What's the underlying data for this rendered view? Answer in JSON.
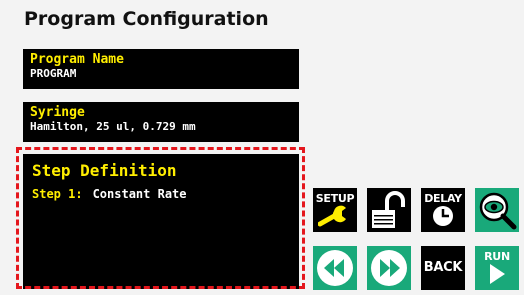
{
  "page": {
    "title": "Program Configuration"
  },
  "program": {
    "label": "Program Name",
    "value": "PROGRAM"
  },
  "syringe": {
    "label": "Syringe",
    "value": "Hamilton, 25 ul, 0.729 mm"
  },
  "step": {
    "title": "Step Definition",
    "number_label": "Step 1:",
    "mode": "Constant Rate"
  },
  "buttons": {
    "setup": "SETUP",
    "lock_icon": "unlocked-padlock-icon",
    "delay": "DELAY",
    "eye_icon": "magnifier-eye-icon",
    "rewind_icon": "rewind-icon",
    "forward_icon": "fast-forward-icon",
    "back": "BACK",
    "run": "RUN"
  },
  "colors": {
    "label_yellow": "#ffee00",
    "highlight_red": "#e4161c",
    "accent_green": "#19a97a",
    "panel_black": "#000000"
  }
}
